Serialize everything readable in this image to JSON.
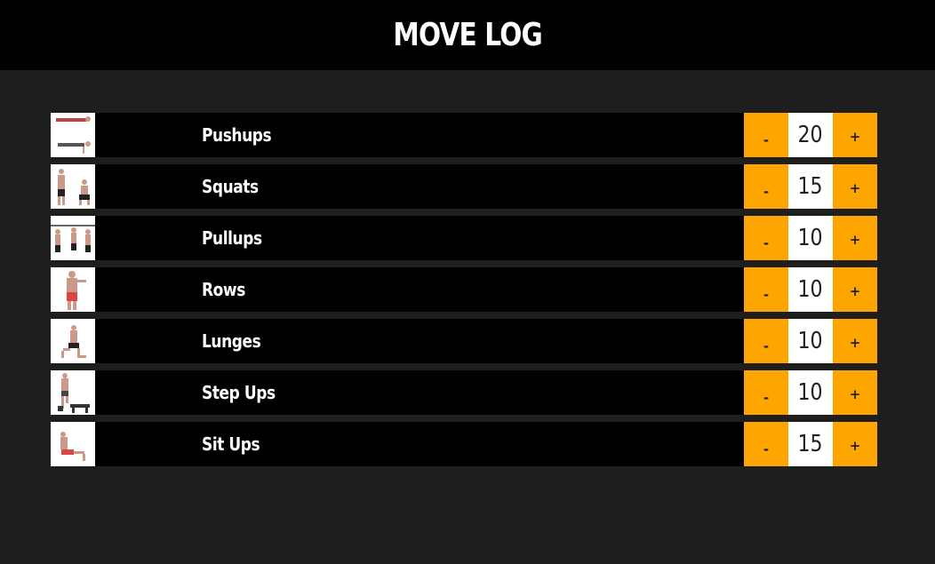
{
  "header": {
    "title": "MOVE LOG"
  },
  "exercises": [
    {
      "name": "Pushups",
      "count": "20",
      "minus_label": "-",
      "plus_label": "+",
      "icon": "pushup-figure-icon"
    },
    {
      "name": "Squats",
      "count": "15",
      "minus_label": "-",
      "plus_label": "+",
      "icon": "squat-figure-icon"
    },
    {
      "name": "Pullups",
      "count": "10",
      "minus_label": "-",
      "plus_label": "+",
      "icon": "pullup-figure-icon"
    },
    {
      "name": "Rows",
      "count": "10",
      "minus_label": "-",
      "plus_label": "+",
      "icon": "row-figure-icon"
    },
    {
      "name": "Lunges",
      "count": "10",
      "minus_label": "-",
      "plus_label": "+",
      "icon": "lunge-figure-icon"
    },
    {
      "name": "Step Ups",
      "count": "10",
      "minus_label": "-",
      "plus_label": "+",
      "icon": "stepup-figure-icon"
    },
    {
      "name": "Sit Ups",
      "count": "15",
      "minus_label": "-",
      "plus_label": "+",
      "icon": "situp-figure-icon"
    }
  ],
  "colors": {
    "background": "#1e1e1e",
    "header": "#000000",
    "row": "#000000",
    "accent": "#ffa500",
    "count_bg": "#ffffff"
  }
}
